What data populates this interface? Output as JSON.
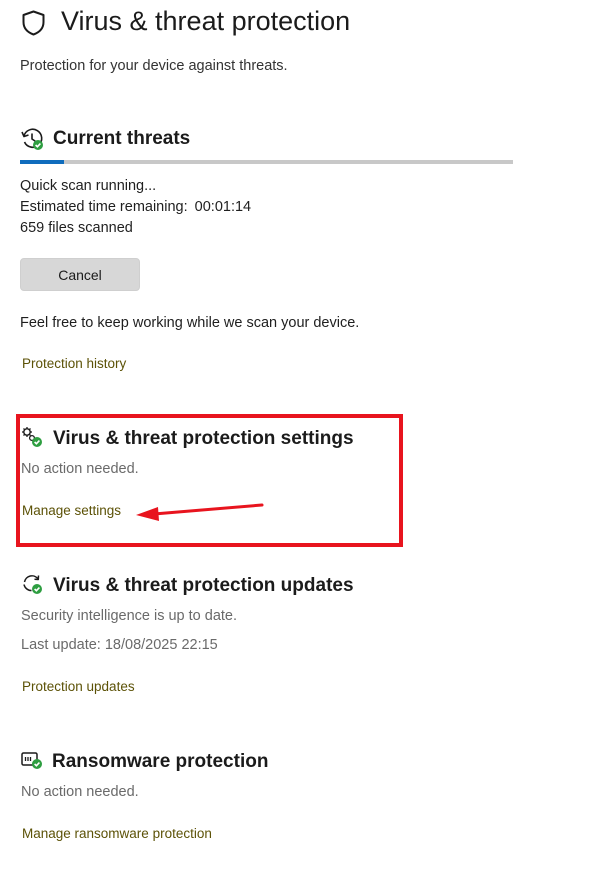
{
  "header": {
    "title": "Virus & threat protection",
    "subtitle": "Protection for your device against threats."
  },
  "current_threats": {
    "title": "Current threats",
    "progress_fraction": 0.09,
    "status": "Quick scan running...",
    "time_label": "Estimated time remaining:",
    "time_value": "00:01:14",
    "files_scanned": "659 files scanned",
    "cancel_label": "Cancel",
    "note": "Feel free to keep working while we scan your device.",
    "history_link": "Protection history"
  },
  "settings": {
    "title": "Virus & threat protection settings",
    "status": "No action needed.",
    "manage_link": "Manage settings"
  },
  "updates": {
    "title": "Virus & threat protection updates",
    "status": "Security intelligence is up to date.",
    "last_update": "Last update: 18/08/2025 22:15",
    "link": "Protection updates"
  },
  "ransomware": {
    "title": "Ransomware protection",
    "status": "No action needed.",
    "link": "Manage ransomware protection"
  },
  "colors": {
    "accent_progress": "#0f6cbd",
    "link": "#5c5207",
    "annotation": "#e8141e",
    "ok_badge": "#2e9e41"
  },
  "icons": {
    "header": "shield-icon",
    "current_threats": "clock-refresh-icon",
    "settings": "gears-check-icon",
    "updates": "refresh-check-icon",
    "ransomware": "ransomware-check-icon"
  }
}
